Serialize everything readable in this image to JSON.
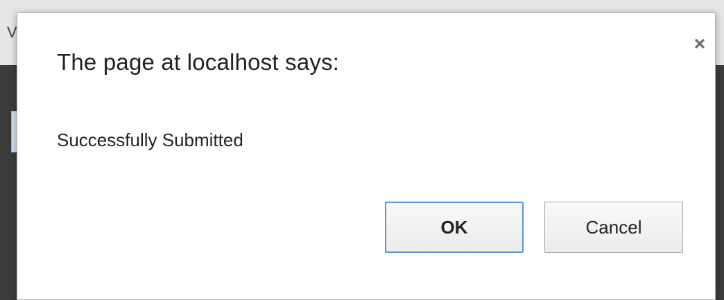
{
  "backdrop": {
    "partial_text": "V"
  },
  "dialog": {
    "title": "The page at localhost says:",
    "message": "Successfully Submitted",
    "close_icon": "close-icon",
    "buttons": {
      "ok_label": "OK",
      "cancel_label": "Cancel"
    }
  },
  "colors": {
    "ok_border": "#5b93d8",
    "dialog_background": "#ffffff",
    "backdrop_dark": "#3c3c3c"
  }
}
